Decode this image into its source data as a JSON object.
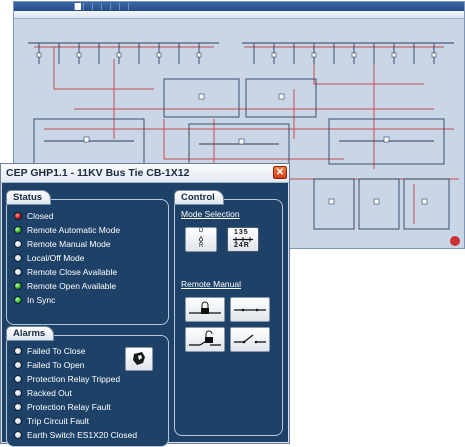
{
  "background_window": {
    "tabs": [
      "",
      "",
      "",
      "",
      "",
      "",
      ""
    ],
    "title_right": ""
  },
  "dialog": {
    "title": "CEP GHP1.1 - 11KV Bus Tie CB-1X12",
    "close_glyph": "✕"
  },
  "status": {
    "label": "Status",
    "items": [
      {
        "label": "Closed",
        "led": "red"
      },
      {
        "label": "Remote Automatic Mode",
        "led": "green"
      },
      {
        "label": "Remote Manual Mode",
        "led": "white"
      },
      {
        "label": "Local/Off Mode",
        "led": "white"
      },
      {
        "label": "Remote Close Available",
        "led": "white"
      },
      {
        "label": "Remote Open Available",
        "led": "green"
      },
      {
        "label": "In Sync",
        "led": "green"
      }
    ]
  },
  "control": {
    "label": "Control",
    "mode_selection_label": "Mode Selection",
    "remote_manual_label": "Remote Manual",
    "mode_dial_top": "135",
    "mode_dial_bottom": "24R",
    "mode_switch_top": "D",
    "mode_switch_bottom": "R"
  },
  "alarms": {
    "label": "Alarms",
    "items": [
      {
        "label": "Failed To Close"
      },
      {
        "label": "Failed To Open"
      },
      {
        "label": "Protection Relay Tripped"
      },
      {
        "label": "Racked Out"
      },
      {
        "label": "Protection Relay Fault"
      },
      {
        "label": "Trip Circuit Fault"
      },
      {
        "label": "Earth Switch ES1X20 Closed"
      }
    ]
  },
  "colors": {
    "panel_background": "#1e4168",
    "led_red": "#c10000",
    "led_green": "#18a010",
    "led_off": "#c8d0da",
    "close_button": "#e05a28"
  }
}
